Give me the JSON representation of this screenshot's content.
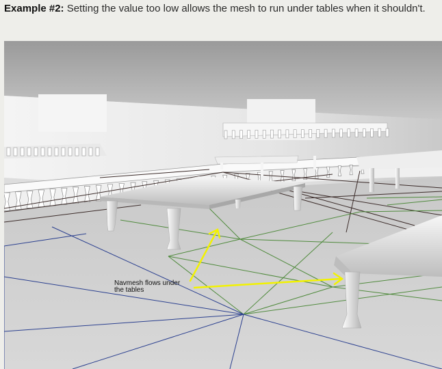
{
  "caption": {
    "label": "Example #2:",
    "text": " Setting the value too low allows the mesh to run under tables when it shouldn't."
  },
  "figure": {
    "annotation_line1": "Navmesh flows under",
    "annotation_line2": "the tables",
    "colors": {
      "ceiling": "#a9a9a9",
      "wall": "#e8e8e8",
      "floor": "#d2d2d2",
      "mesh_green": "#4f8a3c",
      "mesh_blue": "#2a3f8f",
      "mesh_dark": "#3a2a28",
      "arrow": "#f2f200"
    }
  }
}
